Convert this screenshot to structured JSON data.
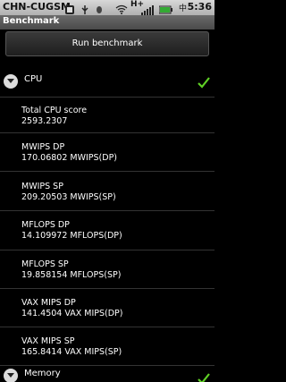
{
  "status_bar": {
    "carrier": "CHN-CUGSM",
    "network": "H+",
    "lang": "中",
    "time": "5:36"
  },
  "app": {
    "title": "Benchmark",
    "run_button": "Run benchmark"
  },
  "cpu": {
    "label": "CPU",
    "rows": [
      {
        "name": "Total CPU score",
        "value": "2593.2307"
      },
      {
        "name": "MWIPS DP",
        "value": "170.06802 MWIPS(DP)"
      },
      {
        "name": "MWIPS SP",
        "value": "209.20503 MWIPS(SP)"
      },
      {
        "name": "MFLOPS DP",
        "value": "14.109972 MFLOPS(DP)"
      },
      {
        "name": "MFLOPS SP",
        "value": "19.858154 MFLOPS(SP)"
      },
      {
        "name": "VAX MIPS DP",
        "value": "141.4504 VAX MIPS(DP)"
      },
      {
        "name": "VAX MIPS SP",
        "value": "165.8414 VAX MIPS(SP)"
      }
    ]
  },
  "memory": {
    "label": "Memory"
  },
  "colors": {
    "check": "#5fd025",
    "background": "#000000"
  }
}
